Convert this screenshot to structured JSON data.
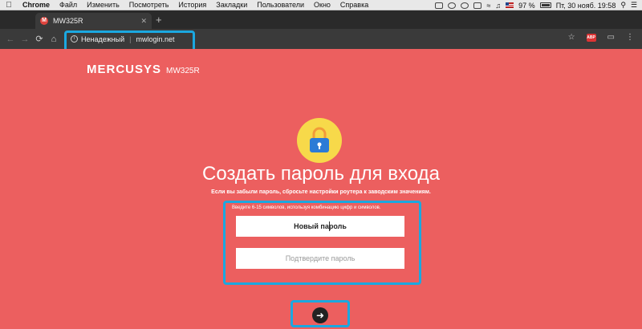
{
  "menubar": {
    "app_name": "Chrome",
    "items": [
      "Файл",
      "Изменить",
      "Посмотреть",
      "История",
      "Закладки",
      "Пользователи",
      "Окно",
      "Справка"
    ],
    "battery_percent": "97 %",
    "datetime": "Пт, 30 нояб.  19:58"
  },
  "browser": {
    "tab_title": "MW325R",
    "tab_favicon_letter": "M",
    "security_label": "Ненадежный",
    "url": "mwlogin.net",
    "extension_badge": "ABP"
  },
  "page": {
    "brand_logo": "MERCUSYS",
    "brand_model": "MW325R",
    "title": "Создать пароль для входа",
    "subtitle": "Если вы забыли пароль, сбросьте настройки роутера к заводским значениям.",
    "hint": "Введите 6-15 символов, используя комбинацию цифр и символов.",
    "new_password_value": "Новый пароль",
    "confirm_password_placeholder": "Подтвердите пароль"
  },
  "colors": {
    "page_bg": "#ec5f5f",
    "highlight": "#1ba8e0",
    "lock_bg": "#f7d94a",
    "lock_body": "#2c7bd6"
  },
  "icons": [
    "apple-icon",
    "favicon",
    "back-arrow-icon",
    "forward-arrow-icon",
    "reload-icon",
    "home-icon",
    "info-icon",
    "star-icon",
    "cast-icon",
    "lock-icon",
    "arrow-right-icon"
  ]
}
